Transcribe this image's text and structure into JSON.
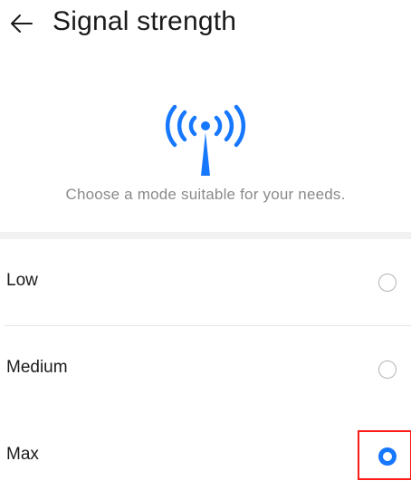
{
  "header": {
    "back_icon": "arrow-left-icon",
    "title": "Signal strength"
  },
  "hero": {
    "icon": "antenna-signal-icon",
    "accent_color": "#1677ff",
    "description": "Choose a mode suitable for your needs."
  },
  "options": [
    {
      "label": "Low",
      "selected": false
    },
    {
      "label": "Medium",
      "selected": false
    },
    {
      "label": "Max",
      "selected": true
    }
  ],
  "highlight_color": "#ff1a1a"
}
